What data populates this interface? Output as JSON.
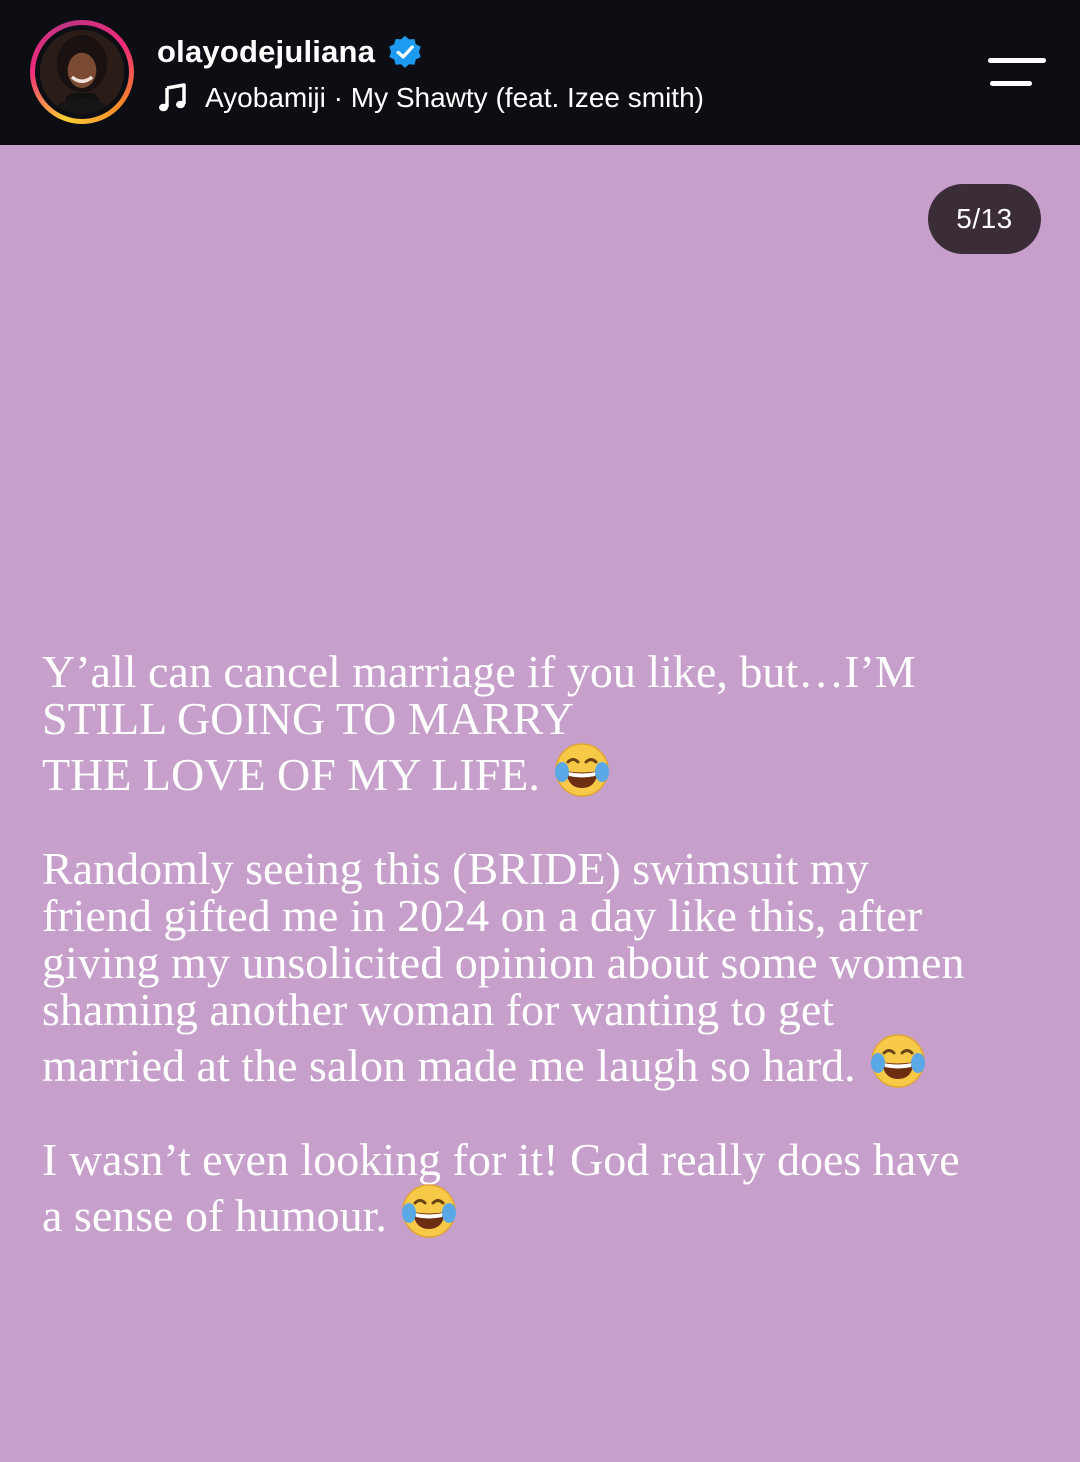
{
  "header": {
    "username": "olayodejuliana",
    "verified_icon": "verified-badge-icon",
    "music_icon": "music-note-icon",
    "track": "Ayobamiji · My Shawty (feat. Izee smith)",
    "menu_icon": "menu-icon"
  },
  "story": {
    "counter": "5/13",
    "background_color": "#c69fcb",
    "paragraphs": [
      {
        "lines": [
          "Y’all can cancel marriage if you like, but…I’M",
          "STILL GOING TO MARRY",
          "THE LOVE OF MY LIFE."
        ]
      },
      {
        "lines": [
          "Randomly seeing this (BRIDE) swimsuit my",
          "friend gifted me in 2024 on a day like this, after",
          "giving my unsolicited opinion about some women",
          "shaming another woman for wanting to get",
          "married at the salon made me laugh so hard."
        ]
      },
      {
        "lines": [
          "I wasn’t even looking for it! God really does have",
          "a sense of humour."
        ]
      }
    ],
    "emoji": "face-with-tears-of-joy-icon"
  },
  "colors": {
    "header_bg": "#0c0e13",
    "verified_blue": "#1d9bf0",
    "counter_bg": "#3a2d38"
  }
}
